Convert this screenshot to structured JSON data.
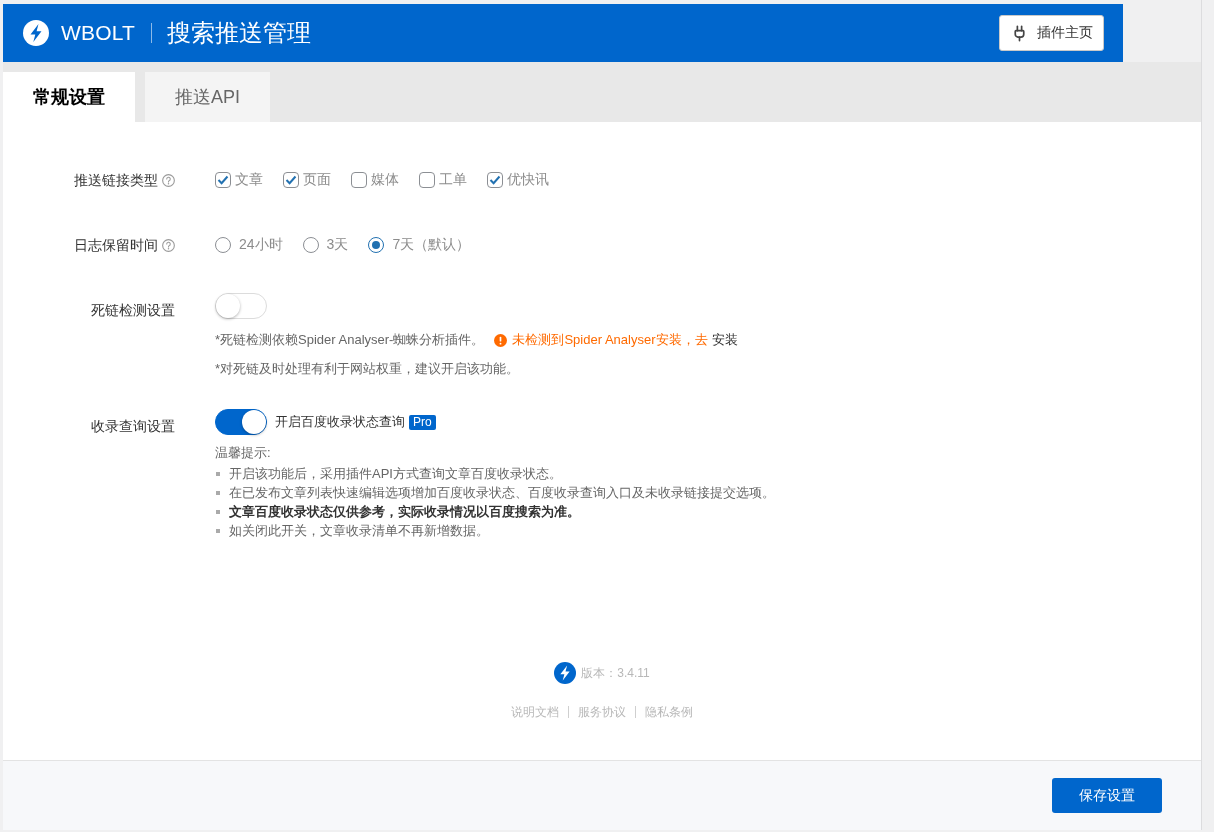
{
  "header": {
    "brand": "WBOLT",
    "title": "搜索推送管理",
    "home_button": "插件主页"
  },
  "tabs": [
    {
      "label": "常规设置",
      "selected": true
    },
    {
      "label": "推送API",
      "selected": false
    }
  ],
  "settings": [
    {
      "kind": "checkboxes",
      "label": "推送链接类型",
      "help": true,
      "options": [
        {
          "label": "文章",
          "checked": true
        },
        {
          "label": "页面",
          "checked": true
        },
        {
          "label": "媒体",
          "checked": false
        },
        {
          "label": "工单",
          "checked": false
        },
        {
          "label": "优快讯",
          "checked": true
        }
      ]
    },
    {
      "kind": "radios",
      "label": "日志保留时间",
      "help": true,
      "options": [
        {
          "label": "24小时",
          "selected": false
        },
        {
          "label": "3天",
          "selected": false
        },
        {
          "label": "7天（默认）",
          "selected": true
        }
      ]
    },
    {
      "kind": "toggle",
      "label": "死链检测设置",
      "help": false,
      "on": false,
      "notes": [
        {
          "text": "*死链检测依赖Spider Analyser-蜘蛛分析插件。",
          "warning": "未检测到Spider Analyser安装，去",
          "link": "安装"
        },
        {
          "text": "*对死链及时处理有利于网站权重，建议开启该功能。"
        }
      ]
    },
    {
      "kind": "toggle",
      "label": "收录查询设置",
      "help": false,
      "on": true,
      "toggle_label": "开启百度收录状态查询",
      "badge": "Pro",
      "tips_title": "温馨提示:",
      "tips": [
        {
          "text": "开启该功能后，采用插件API方式查询文章百度收录状态。",
          "bold": false
        },
        {
          "text": "在已发布文章列表快速编辑选项增加百度收录状态、百度收录查询入口及未收录链接提交选项。",
          "bold": false
        },
        {
          "text": "文章百度收录状态仅供参考，实际收录情况以百度搜索为准。",
          "bold": true
        },
        {
          "text": "如关闭此开关，文章收录清单不再新增数据。",
          "bold": false
        }
      ]
    }
  ],
  "footer": {
    "version": "版本：3.4.11",
    "links": [
      "说明文档",
      "服务协议",
      "隐私条例"
    ]
  },
  "save_button": "保存设置"
}
